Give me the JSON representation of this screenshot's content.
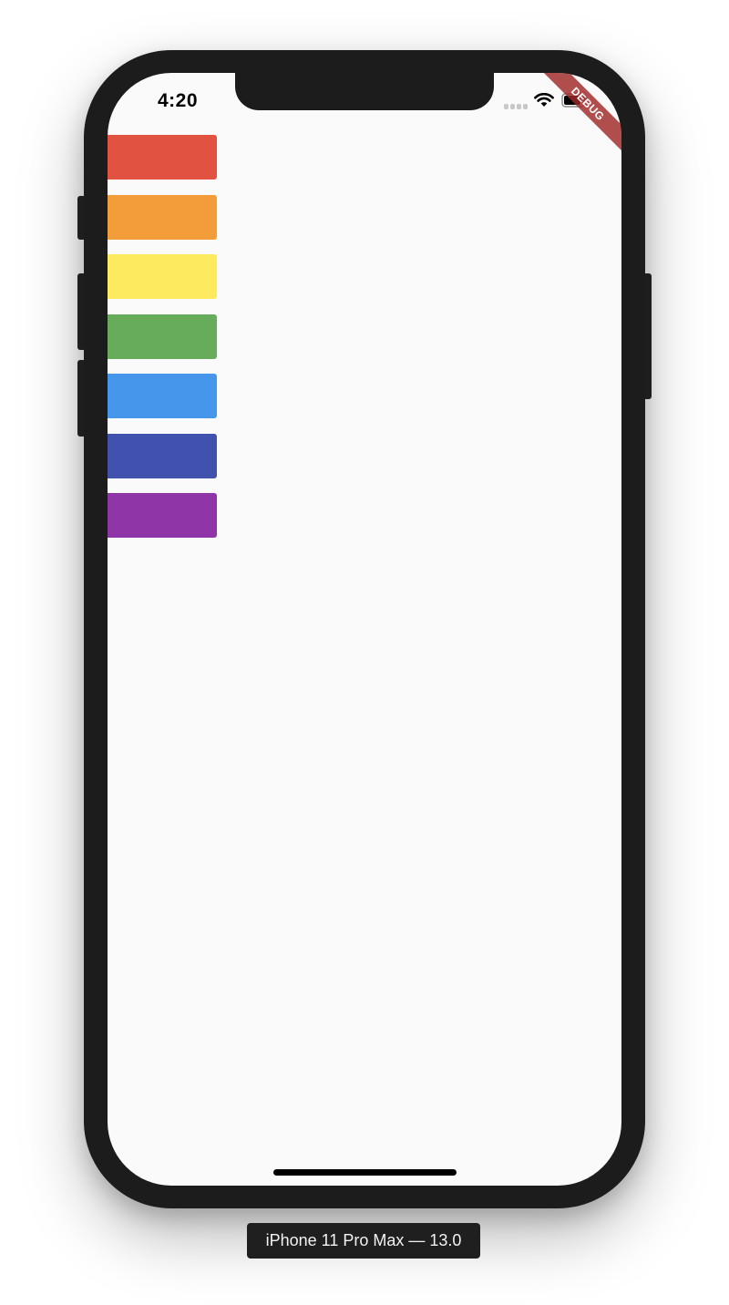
{
  "status_bar": {
    "time": "4:20",
    "signal_icon": "cellular-signal-icon",
    "wifi_icon": "wifi-icon",
    "battery_icon": "battery-icon"
  },
  "debug_banner": {
    "label": "DEBUG"
  },
  "color_boxes": [
    {
      "name": "red",
      "color": "#E25241"
    },
    {
      "name": "orange",
      "color": "#F39C3A"
    },
    {
      "name": "yellow",
      "color": "#FEEA5E"
    },
    {
      "name": "green",
      "color": "#67AC5B"
    },
    {
      "name": "blue",
      "color": "#4696EC"
    },
    {
      "name": "indigo",
      "color": "#4152AE"
    },
    {
      "name": "purple",
      "color": "#8F35A8"
    }
  ],
  "device_label": "iPhone 11 Pro Max — 13.0"
}
